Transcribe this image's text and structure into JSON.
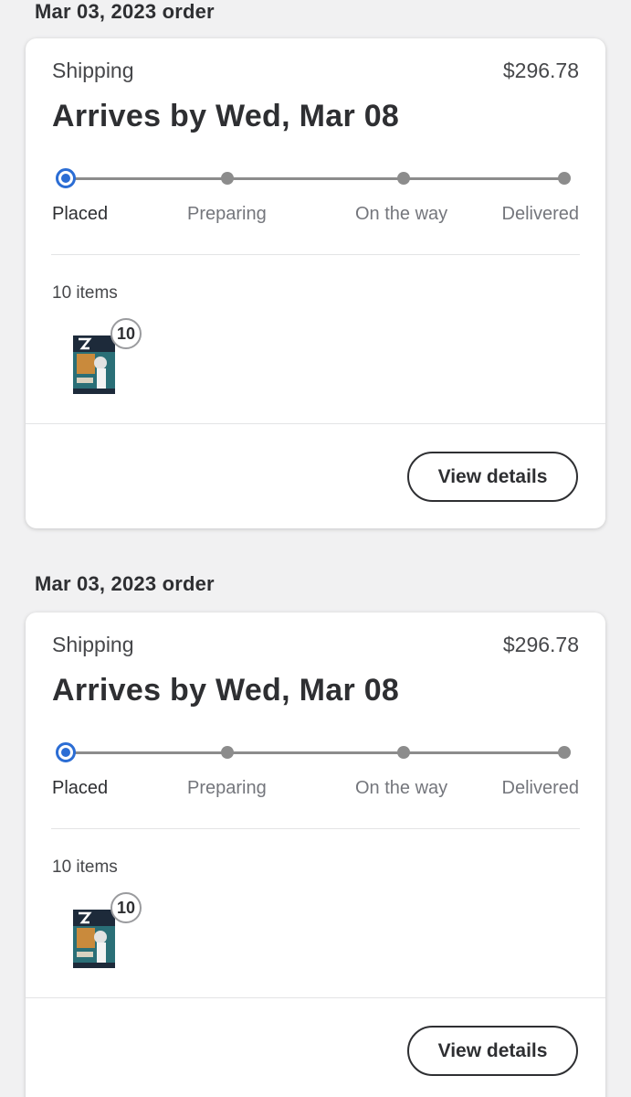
{
  "orders": [
    {
      "header": "Mar 03, 2023 order",
      "status": "Shipping",
      "price": "$296.78",
      "arrival": "Arrives by Wed, Mar 08",
      "stages": [
        "Placed",
        "Preparing",
        "On the way",
        "Delivered"
      ],
      "active_stage": "Placed",
      "items_count": "10 items",
      "item_qty": "10",
      "button_label": "View details"
    },
    {
      "header": "Mar 03, 2023 order",
      "status": "Shipping",
      "price": "$296.78",
      "arrival": "Arrives by Wed, Mar 08",
      "stages": [
        "Placed",
        "Preparing",
        "On the way",
        "Delivered"
      ],
      "active_stage": "Placed",
      "items_count": "10 items",
      "item_qty": "10",
      "button_label": "View details"
    }
  ],
  "colors": {
    "progress_active": "#2b6dd4",
    "progress_inactive": "#8c8c8c",
    "text_primary": "#2e2f32",
    "background": "#f1f1f2"
  },
  "icons": {
    "thumbnail": "product-box-thumbnail"
  }
}
